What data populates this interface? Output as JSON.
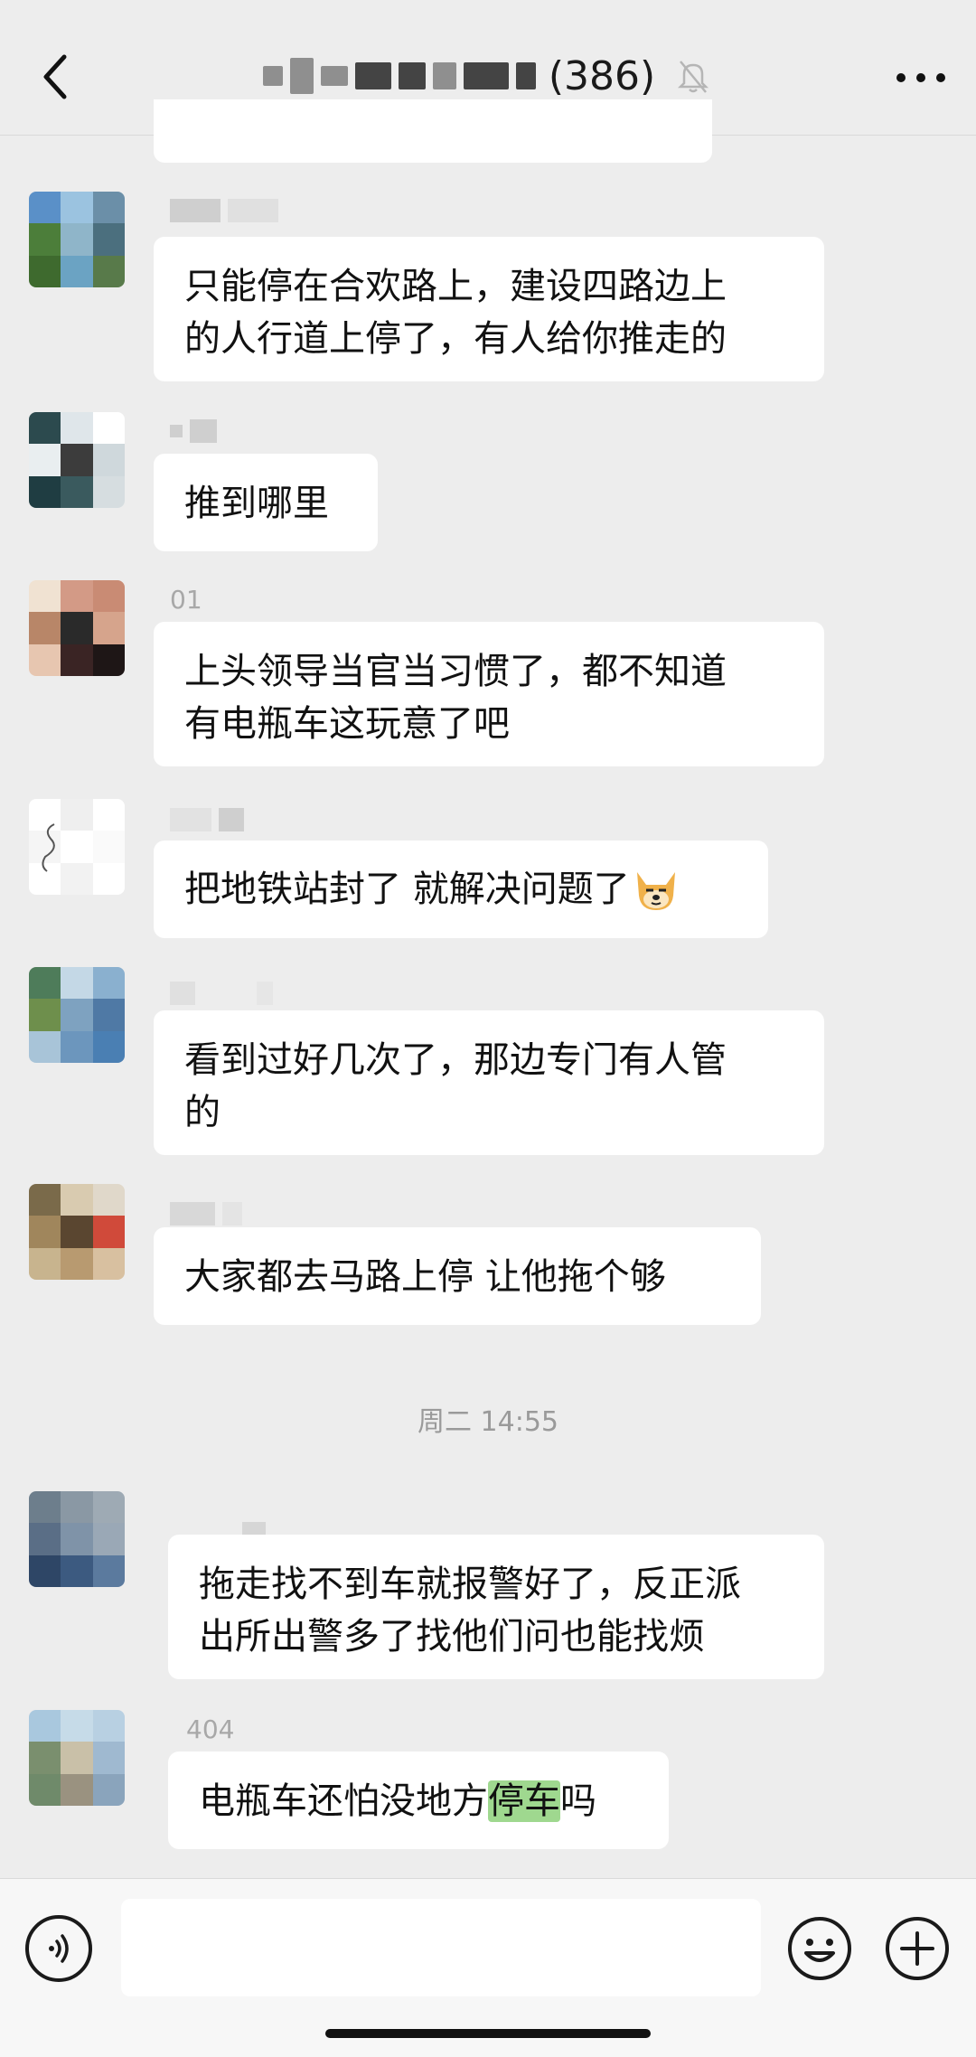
{
  "header": {
    "title_count": "(386)",
    "back_icon": "chevron-left-icon",
    "mute_icon": "bell-muted-icon",
    "more_icon": "more-horizontal-icon"
  },
  "messages": [
    {
      "name": "",
      "lines": [
        "只能停在合欢路上，建设四路边上",
        "的人行道上停了，有人给你推走的"
      ]
    },
    {
      "name": "",
      "lines": [
        "推到哪里"
      ]
    },
    {
      "name": "01",
      "lines": [
        "上头领导当官当习惯了，都不知道",
        "有电瓶车这玩意了吧"
      ]
    },
    {
      "name": "",
      "lines": [
        "把地铁站封了 就解决问题了"
      ],
      "emoji": "doge-emoji"
    },
    {
      "name": "",
      "lines": [
        "看到过好几次了，那边专门有人管",
        "的"
      ]
    },
    {
      "name": "",
      "lines": [
        "大家都去马路上停 让他拖个够"
      ]
    },
    {
      "name": "",
      "lines": [
        "拖走找不到车就报警好了，反正派",
        "出所出警多了找他们问也能找烦"
      ]
    },
    {
      "name": "404",
      "before": "电瓶车还怕没地方",
      "highlight": "停车",
      "after": "吗"
    }
  ],
  "timestamp": "周二 14:55",
  "input": {
    "value": "",
    "voice_icon": "voice-icon",
    "emoji_icon": "emoji-icon",
    "plus_icon": "plus-icon"
  },
  "colors": {
    "background": "#ededed",
    "bubble": "#ffffff",
    "highlight": "#9fd88f",
    "text": "#111111",
    "meta": "#9a9a9a"
  }
}
